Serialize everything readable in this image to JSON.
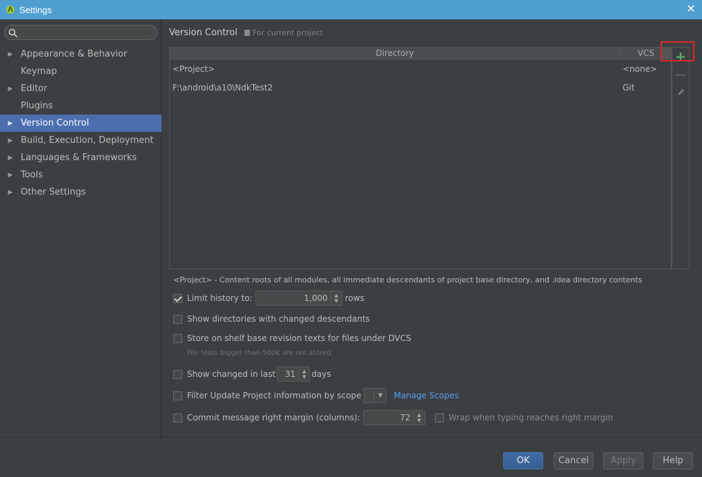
{
  "window": {
    "title": "Settings",
    "close_icon": "close-icon"
  },
  "sidebar": {
    "search_placeholder": "",
    "items": [
      {
        "label": "Appearance & Behavior",
        "expandable": true,
        "selected": false
      },
      {
        "label": "Keymap",
        "expandable": false,
        "selected": false
      },
      {
        "label": "Editor",
        "expandable": true,
        "selected": false
      },
      {
        "label": "Plugins",
        "expandable": false,
        "selected": false
      },
      {
        "label": "Version Control",
        "expandable": true,
        "selected": true
      },
      {
        "label": "Build, Execution, Deployment",
        "expandable": true,
        "selected": false
      },
      {
        "label": "Languages & Frameworks",
        "expandable": true,
        "selected": false
      },
      {
        "label": "Tools",
        "expandable": true,
        "selected": false
      },
      {
        "label": "Other Settings",
        "expandable": true,
        "selected": false
      }
    ]
  },
  "main": {
    "title": "Version Control",
    "subtitle": "For current project",
    "table": {
      "columns": [
        "Directory",
        "VCS"
      ],
      "rows": [
        {
          "directory": "<Project>",
          "vcs": "<none>"
        },
        {
          "directory": "F:\\android\\a10\\NdkTest2",
          "vcs": "Git"
        }
      ]
    },
    "toolbar": {
      "add": "+",
      "remove": "—"
    },
    "note": "<Project> - Content roots of all modules, all immediate descendants of project base directory, and .idea directory contents",
    "options": {
      "limit_history": {
        "label": "Limit history to:",
        "value": "1,000",
        "suffix": "rows",
        "checked": true
      },
      "show_dirs": {
        "label": "Show directories with changed descendants",
        "checked": false
      },
      "store_shelf": {
        "label": "Store on shelf base revision texts for files under DVCS",
        "checked": false,
        "note": "File texts bigger than 500K are not stored"
      },
      "show_changed": {
        "label": "Show changed in last",
        "value": "31",
        "suffix": "days",
        "checked": false
      },
      "filter_update": {
        "label": "Filter Update Project information by scope",
        "link": "Manage Scopes",
        "checked": false
      },
      "commit_margin": {
        "label": "Commit message right margin (columns):",
        "value": "72",
        "checked": false,
        "wrap_label": "Wrap when typing reaches right margin"
      }
    }
  },
  "footer": {
    "ok": "OK",
    "cancel": "Cancel",
    "apply": "Apply",
    "help": "Help"
  }
}
